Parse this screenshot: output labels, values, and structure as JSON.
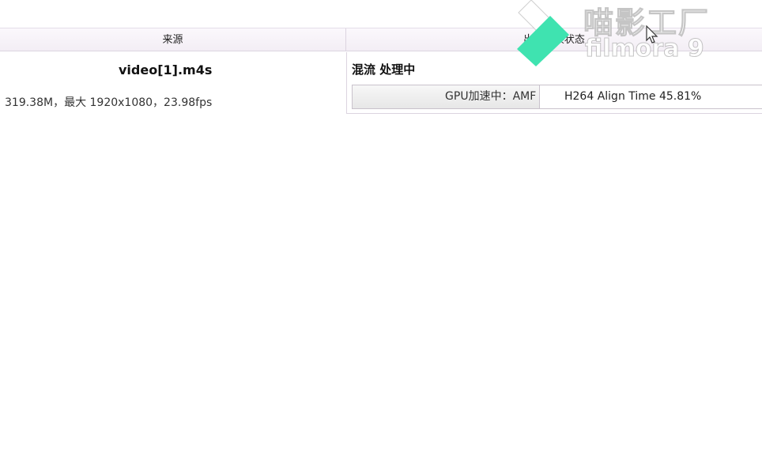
{
  "columns": {
    "source_label": "来源",
    "output_label": "出 / 转换状态"
  },
  "source": {
    "file_name": "video[1].m4s",
    "file_info": "319.38M，最大 1920x1080，23.98fps"
  },
  "output": {
    "status_title": "混流 处理中",
    "progress_label": "GPU加速中：AMF",
    "progress_detail": "H264 Align Time 45.81%",
    "progress_fraction": 0.4581
  },
  "watermark": {
    "brand_cn": "喵影工厂",
    "brand_en": "filmora 9",
    "logo_colors": [
      "#ffffff",
      "#3fe3b0"
    ]
  },
  "icons": {
    "cursor": "mouse-pointer-icon",
    "logo": "filmora-logo-icon"
  }
}
